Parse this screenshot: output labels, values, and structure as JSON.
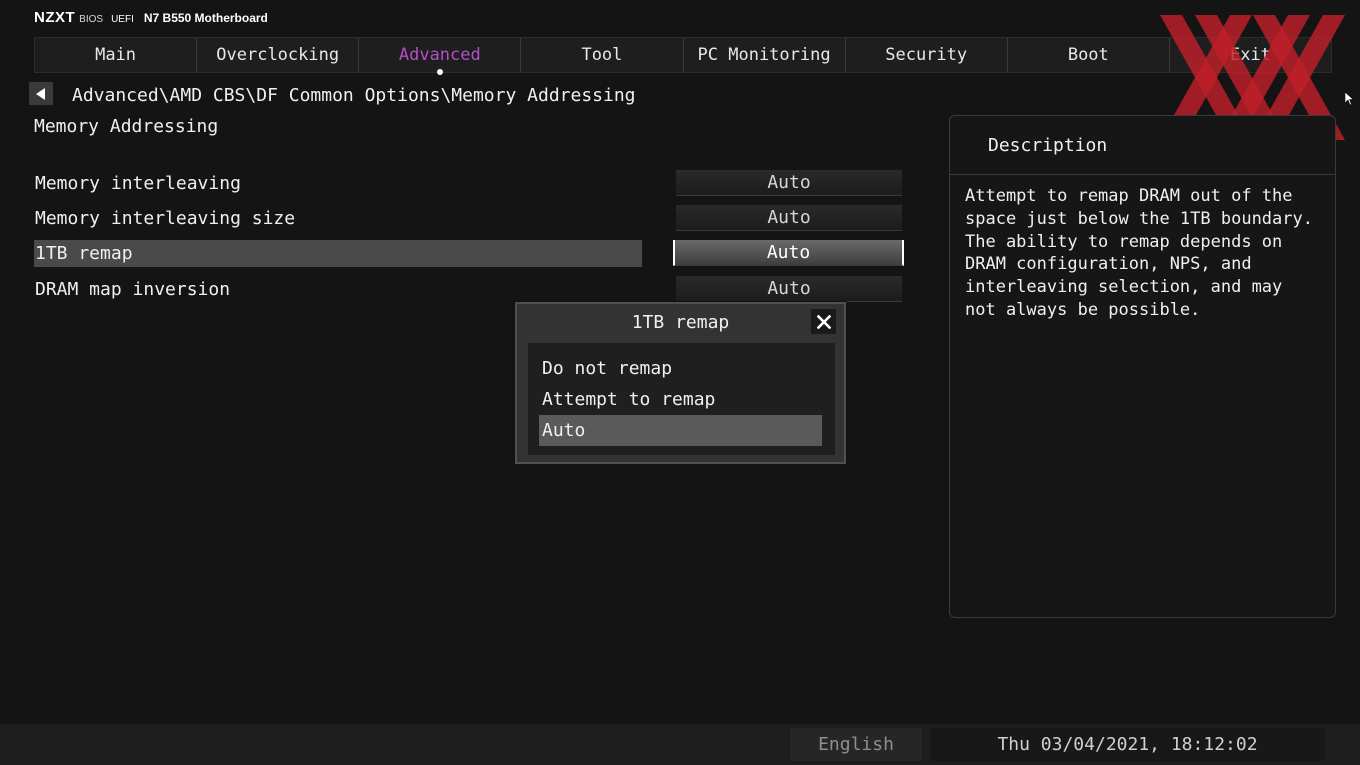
{
  "brand": {
    "logo": "NZXT",
    "bios": "BIOS",
    "uefi": "UEFI",
    "model": "N7 B550 Motherboard"
  },
  "tabs": [
    {
      "label": "Main"
    },
    {
      "label": "Overclocking"
    },
    {
      "label": "Advanced",
      "active": true
    },
    {
      "label": "Tool"
    },
    {
      "label": "PC Monitoring"
    },
    {
      "label": "Security"
    },
    {
      "label": "Boot"
    },
    {
      "label": "Exit"
    }
  ],
  "accent_color": "#b44fc9",
  "breadcrumb": "Advanced\\AMD CBS\\DF Common Options\\Memory Addressing",
  "page_title": "Memory Addressing",
  "settings": [
    {
      "label": "Memory interleaving",
      "value": "Auto"
    },
    {
      "label": "Memory interleaving size",
      "value": "Auto"
    },
    {
      "label": "1TB remap",
      "value": "Auto",
      "selected": true
    },
    {
      "label": "DRAM map inversion",
      "value": "Auto"
    }
  ],
  "description": {
    "title": "Description",
    "text": "Attempt to remap DRAM out of the space just below the 1TB boundary. The ability to remap depends on DRAM configuration, NPS, and interleaving selection, and may not always be possible."
  },
  "popup": {
    "title": "1TB remap",
    "options": [
      "Do not remap",
      "Attempt to remap",
      "Auto"
    ],
    "selected": "Auto"
  },
  "footer": {
    "language": "English",
    "datetime": "Thu 03/04/2021, 18:12:02"
  },
  "icons": {
    "back": "back-arrow-icon",
    "close": "close-icon",
    "watermark": "xx-watermark-logo",
    "cursor": "mouse-cursor-icon"
  }
}
